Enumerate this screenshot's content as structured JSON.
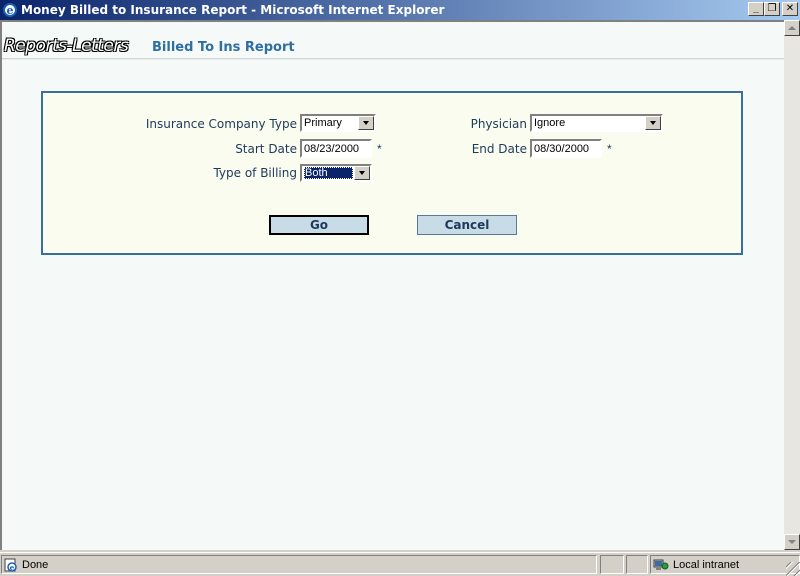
{
  "window": {
    "title": "Money Billed to Insurance Report - Microsoft Internet Explorer",
    "minimize": "_",
    "restore": "❐",
    "close": "✕"
  },
  "header": {
    "logo_text": "Reports-Letters",
    "subtitle": "Billed To Ins Report"
  },
  "form": {
    "insurance_type_label": "Insurance Company Type",
    "insurance_type_value": "Primary",
    "physician_label": "Physician",
    "physician_value": "Ignore",
    "start_date_label": "Start Date",
    "start_date_value": "08/23/2000",
    "end_date_label": "End Date",
    "end_date_value": "08/30/2000",
    "required_marker": "*",
    "billing_type_label": "Type of Billing",
    "billing_type_value": "Both",
    "go_label": "Go",
    "cancel_label": "Cancel"
  },
  "status": {
    "text": "Done",
    "zone": "Local intranet"
  },
  "colors": {
    "accent": "#3a6e9e",
    "panel_bg": "#fafcf0",
    "page_bg": "#f5faf8",
    "button_bg": "#c8dce8"
  }
}
